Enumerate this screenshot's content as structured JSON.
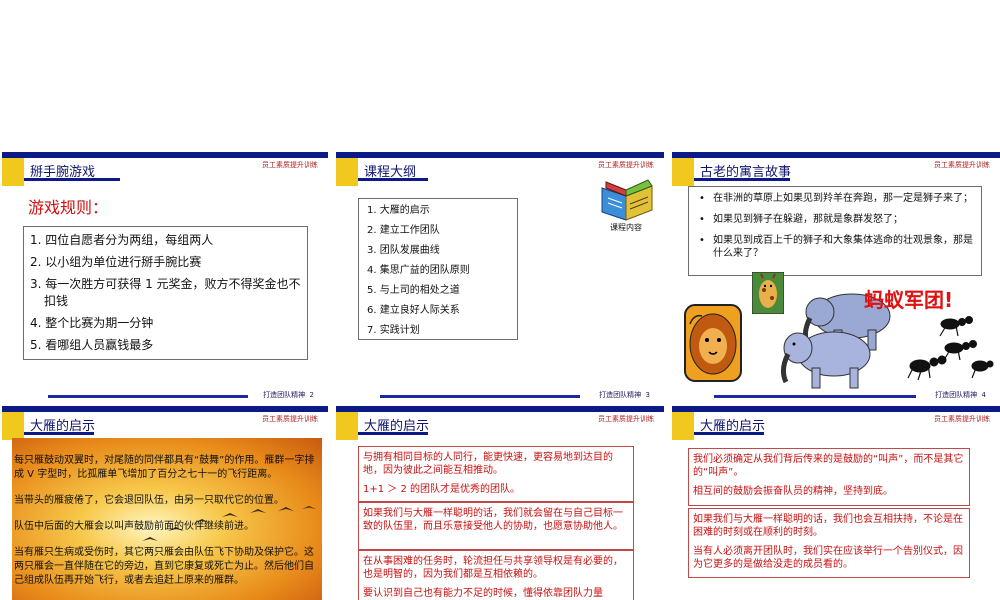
{
  "slides": [
    {
      "title": "掰手腕游戏",
      "brand": "员工素质提升训练",
      "subtitle": "游戏规则：",
      "rules": [
        "1. 四位自愿者分为两组，每组两人",
        "2. 以小组为单位进行掰手腕比赛",
        "3. 每一次胜方可获得 1 元奖金，败方不得奖金也不扣钱",
        "4. 整个比赛为期一分钟",
        "5. 看哪组人员赢钱最多"
      ],
      "footer": "打造团队精神",
      "page": "2"
    },
    {
      "title": "课程大纲",
      "brand": "员工素质提升训练",
      "outline": [
        "1.  大雁的启示",
        "2.  建立工作团队",
        "3.  团队发展曲线",
        "4.  集思广益的团队原则",
        "5.  与上司的相处之道",
        "6.  建立良好人际关系",
        "7.  实践计划"
      ],
      "book_caption": "课程内容",
      "footer": "打造团队精神",
      "page": "3"
    },
    {
      "title": "古老的寓言故事",
      "brand": "员工素质提升训练",
      "bullets": [
        "在非洲的草原上如果见到羚羊在奔跑，那一定是狮子来了；",
        "如果见到狮子在躲避，那就是象群发怒了；",
        "如果见到成百上千的狮子和大象集体逃命的壮观景象，那是什么来了？"
      ],
      "callout": "蚂蚁军团!",
      "footer": "打造团队精神",
      "page": "4"
    },
    {
      "title": "大雁的启示",
      "brand": "员工素质提升训练",
      "paragraphs": [
        "每只雁鼓动双翼时，对尾随的同伴都具有“鼓舞”的作用。雁群一字排成 V 字型时，比孤雁单飞增加了百分之七十一的飞行距离。",
        "当带头的雁疲倦了，它会退回队伍，由另一只取代它的位置。",
        "队伍中后面的大雁会以叫声鼓励前面的伙伴继续前进。",
        "当有雁只生病或受伤时，其它两只雁会由队伍飞下协助及保护它。这两只雁会一直伴随在它的旁边，直到它康复或死亡为止。然后他们自己组成队伍再开始飞行，或者去追赶上原来的雁群。"
      ]
    },
    {
      "title": "大雁的启示",
      "brand": "员工素质提升训练",
      "blocks": [
        [
          "与拥有相同目标的人同行，能更快速，更容易地到达目的地，因为彼此之间能互相推动。",
          "1+1 ＞ 2  的团队才是优秀的团队。"
        ],
        [
          "如果我们与大雁一样聪明的话，我们就会留在与自己目标一致的队伍里，而且乐意接受他人的协助，也愿意协助他人。"
        ],
        [
          "在从事困难的任务时，轮流担任与共享领导权是有必要的，也是明智的，因为我们都是互相依赖的。",
          "要认识到自己也有能力不足的时候，懂得依靠团队力量"
        ]
      ]
    },
    {
      "title": "大雁的启示",
      "brand": "员工素质提升训练",
      "blocks": [
        [
          "我们必须确定从我们背后传来的是鼓励的“叫声”，而不是其它的“叫声”。",
          "相互间的鼓励会振奋队员的精神，坚持到底。"
        ],
        [
          "如果我们与大雁一样聪明的话，我们也会互相扶持，不论是在困难的时刻或在顺利的时刻。",
          "当有人必须离开团队时，我们实在应该举行一个告别仪式，因为它更多的是做给没走的成员看的。"
        ]
      ]
    }
  ],
  "colors": {
    "header_bar": "#0c1a88",
    "header_tab": "#f0c81e",
    "brand_text": "#b02020",
    "rules_title": "#d01010",
    "callout": "#e01010"
  },
  "icons": [
    "book-icon",
    "giraffe-icon",
    "lion-icon",
    "elephant-icon",
    "ant-icon"
  ]
}
